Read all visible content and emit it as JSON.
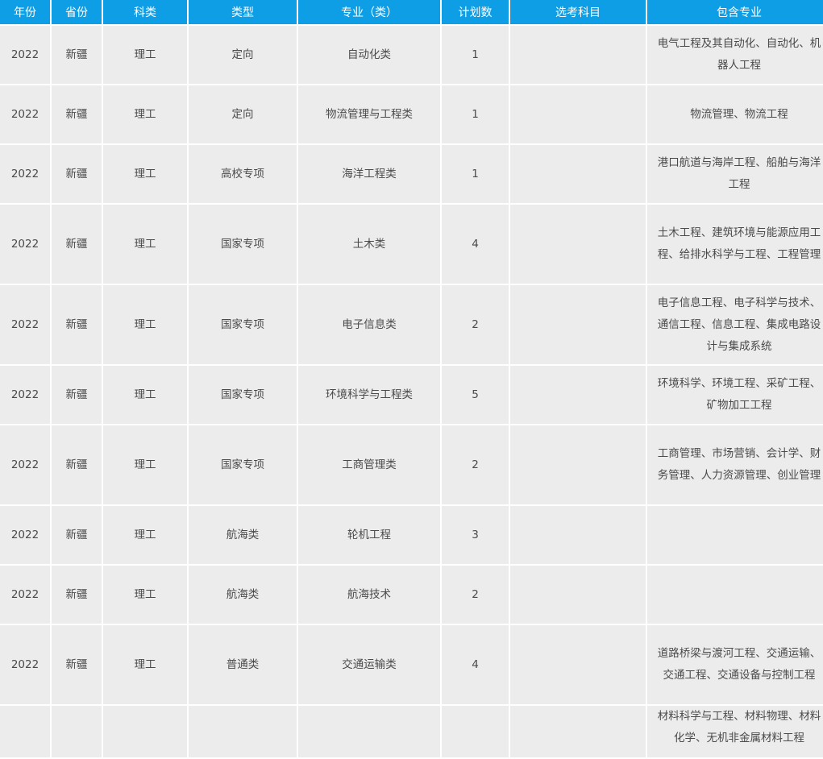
{
  "headers": [
    "年份",
    "省份",
    "科类",
    "类型",
    "专业（类）",
    "计划数",
    "选考科目",
    "包含专业"
  ],
  "rows": [
    {
      "year": "2022",
      "province": "新疆",
      "subject": "理工",
      "type": "定向",
      "major": "自动化类",
      "plan": "1",
      "elective": "",
      "includes": "电气工程及其自动化、自动化、机器人工程"
    },
    {
      "year": "2022",
      "province": "新疆",
      "subject": "理工",
      "type": "定向",
      "major": "物流管理与工程类",
      "plan": "1",
      "elective": "",
      "includes": "物流管理、物流工程"
    },
    {
      "year": "2022",
      "province": "新疆",
      "subject": "理工",
      "type": "高校专项",
      "major": "海洋工程类",
      "plan": "1",
      "elective": "",
      "includes": "港口航道与海岸工程、船舶与海洋工程"
    },
    {
      "year": "2022",
      "province": "新疆",
      "subject": "理工",
      "type": "国家专项",
      "major": "土木类",
      "plan": "4",
      "elective": "",
      "includes": "土木工程、建筑环境与能源应用工程、给排水科学与工程、工程管理"
    },
    {
      "year": "2022",
      "province": "新疆",
      "subject": "理工",
      "type": "国家专项",
      "major": "电子信息类",
      "plan": "2",
      "elective": "",
      "includes": "电子信息工程、电子科学与技术、通信工程、信息工程、集成电路设计与集成系统"
    },
    {
      "year": "2022",
      "province": "新疆",
      "subject": "理工",
      "type": "国家专项",
      "major": "环境科学与工程类",
      "plan": "5",
      "elective": "",
      "includes": "环境科学、环境工程、采矿工程、矿物加工工程"
    },
    {
      "year": "2022",
      "province": "新疆",
      "subject": "理工",
      "type": "国家专项",
      "major": "工商管理类",
      "plan": "2",
      "elective": "",
      "includes": "工商管理、市场营销、会计学、财务管理、人力资源管理、创业管理"
    },
    {
      "year": "2022",
      "province": "新疆",
      "subject": "理工",
      "type": "航海类",
      "major": "轮机工程",
      "plan": "3",
      "elective": "",
      "includes": ""
    },
    {
      "year": "2022",
      "province": "新疆",
      "subject": "理工",
      "type": "航海类",
      "major": "航海技术",
      "plan": "2",
      "elective": "",
      "includes": ""
    },
    {
      "year": "2022",
      "province": "新疆",
      "subject": "理工",
      "type": "普通类",
      "major": "交通运输类",
      "plan": "4",
      "elective": "",
      "includes": "道路桥梁与渡河工程、交通运输、交通工程、交通设备与控制工程"
    },
    {
      "year": "",
      "province": "",
      "subject": "",
      "type": "",
      "major": "",
      "plan": "",
      "elective": "",
      "includes": "材料科学与工程、材料物理、材料化学、无机非金属材料工程"
    }
  ]
}
